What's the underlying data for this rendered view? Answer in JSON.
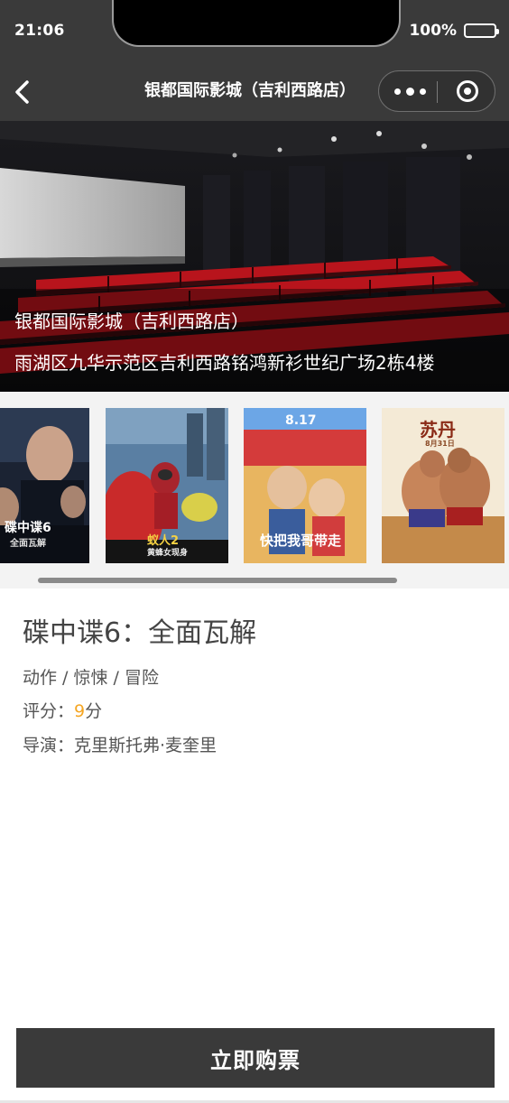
{
  "status_bar": {
    "time": "21:06",
    "battery": "100%"
  },
  "nav": {
    "title": "银都国际影城（吉利西路店）"
  },
  "cinema": {
    "name": "银都国际影城（吉利西路店）",
    "address": "雨湖区九华示范区吉利西路铭鸿新衫世纪广场2栋4楼"
  },
  "posters": [
    {
      "text": "碟中谍6",
      "sub": "全面瓦解"
    },
    {
      "text": "蚁人2",
      "sub": "黄蜂女现身"
    },
    {
      "text": "快把我哥带走",
      "sub": "8.17"
    },
    {
      "text": "苏丹",
      "sub": "8月31日"
    }
  ],
  "movie": {
    "title": "碟中谍6：全面瓦解",
    "genre": "动作 / 惊悚 / 冒险",
    "rating_label": "评分：",
    "rating_value": "9",
    "rating_unit": "分",
    "director": "导演：克里斯托弗·麦奎里"
  },
  "buy_button": {
    "label": "立即购票"
  },
  "colors": {
    "bar": "#3a3a3a",
    "accent_rating": "#f5a623",
    "strip_bg": "#f3f3f3"
  }
}
